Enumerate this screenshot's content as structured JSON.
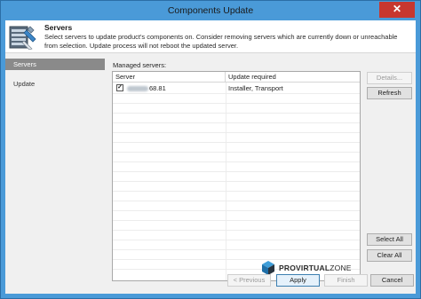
{
  "window": {
    "title": "Components Update",
    "close_glyph": "✕"
  },
  "header": {
    "title": "Servers",
    "description": "Select servers to update product's components on. Consider removing servers which are currently down or unreachable from selection. Update process will not reboot the updated server.",
    "icon": "server-settings-icon"
  },
  "nav": {
    "items": [
      {
        "label": "Servers",
        "active": true
      },
      {
        "label": "Update",
        "active": false
      }
    ]
  },
  "servers": {
    "label": "Managed servers:",
    "columns": [
      "Server",
      "Update required"
    ],
    "rows": [
      {
        "checked": true,
        "server": "68.81",
        "update": "Installer, Transport"
      }
    ]
  },
  "side_buttons": {
    "details": "Details...",
    "refresh": "Refresh",
    "select_all": "Select All",
    "clear_all": "Clear All"
  },
  "watermark": {
    "bold": "PROVIRTUAL",
    "rest": "ZONE"
  },
  "footer": {
    "previous": "< Previous",
    "apply": "Apply",
    "finish": "Finish",
    "cancel": "Cancel"
  },
  "colors": {
    "title_bar": "#4a9ad8",
    "close": "#c7372f",
    "nav_active": "#8a8a8a"
  }
}
